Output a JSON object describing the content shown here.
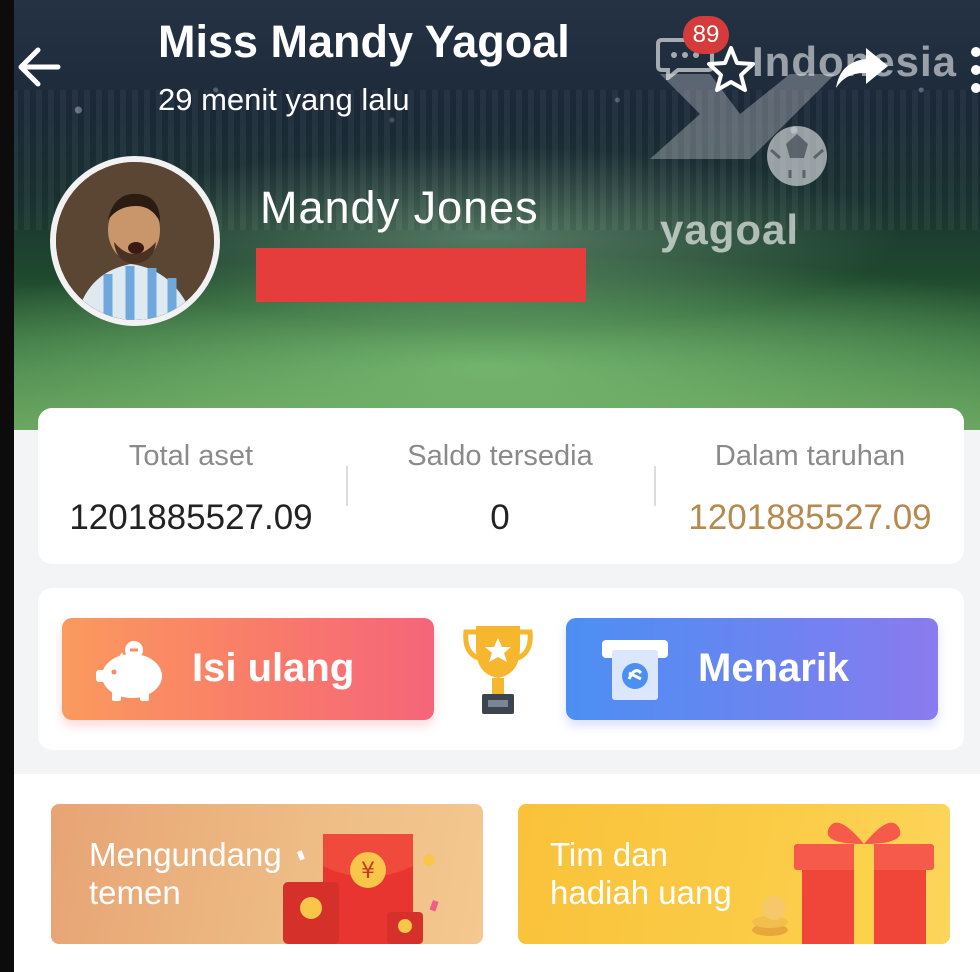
{
  "header": {
    "title": "Miss Mandy Yagoal",
    "subtitle": "29 menit yang lalu",
    "watermark_text": "Indonesia",
    "chat_badge": "89",
    "logo_text": "yagoal"
  },
  "profile": {
    "name": "Mandy Jones"
  },
  "assets": [
    {
      "label": "Total aset",
      "value": "1201885527.09"
    },
    {
      "label": "Saldo tersedia",
      "value": "0"
    },
    {
      "label": "Dalam taruhan",
      "value": "1201885527.09"
    }
  ],
  "actions": {
    "topup_label": "Isi ulang",
    "withdraw_label": "Menarik"
  },
  "promos": {
    "invite_line1": "Mengundang",
    "invite_line2": "temen",
    "task_line1": "Tim dan",
    "task_line2": "hadiah uang"
  },
  "colors": {
    "redaction": "#e53c3c",
    "gold_value": "#b48a4e",
    "topup_gradient_start": "#fb9a5e",
    "withdraw_gradient_start": "#4c8ff3"
  },
  "icons": [
    "back-arrow-icon",
    "chat-icon",
    "star-icon",
    "share-icon",
    "more-vertical-icon",
    "piggy-bank-icon",
    "trophy-icon",
    "atm-withdraw-icon",
    "red-envelope-icon",
    "gift-box-icon"
  ]
}
